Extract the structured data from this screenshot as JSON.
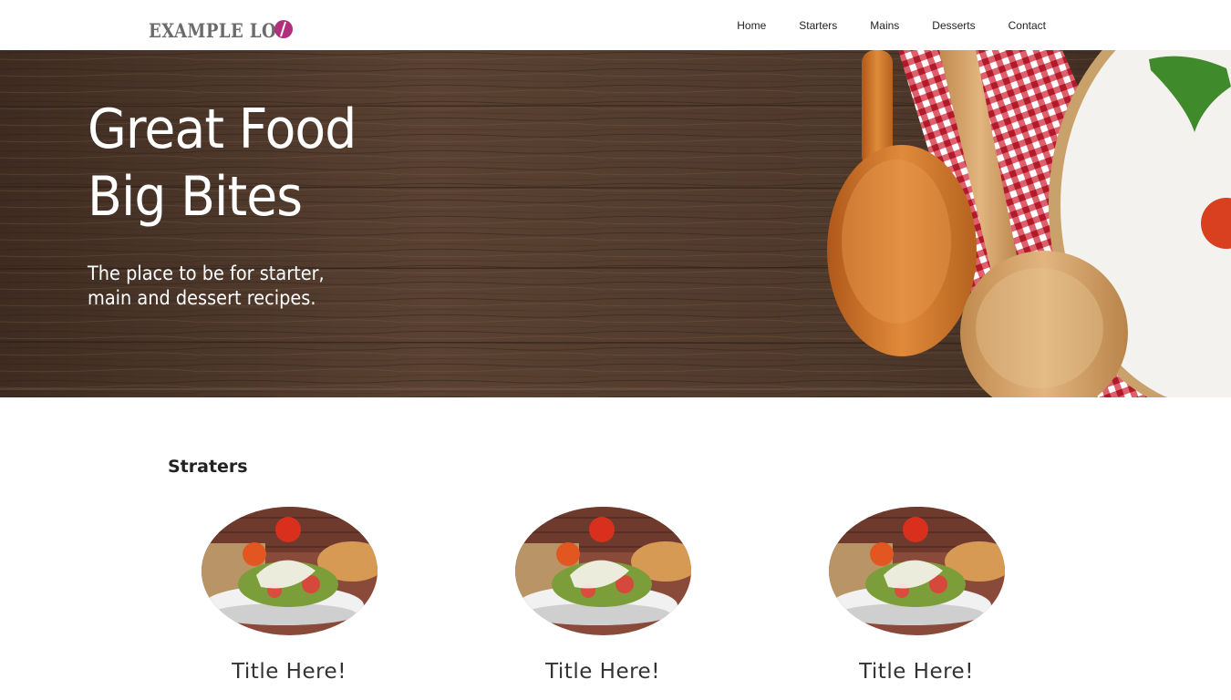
{
  "header": {
    "logo_text": "EXAMPLE LOG",
    "nav": [
      "Home",
      "Starters",
      "Mains",
      "Desserts",
      "Contact"
    ]
  },
  "hero": {
    "title_line1": "Great Food",
    "title_line2": "Big Bites",
    "subtitle_line1": "The place to be for starter,",
    "subtitle_line2": "main and dessert recipes."
  },
  "section": {
    "title": "Straters",
    "cards": [
      {
        "title": "Title Here!"
      },
      {
        "title": "Title Here!"
      },
      {
        "title": "Title Here!"
      }
    ]
  },
  "colors": {
    "logo_accent": "#b0307e",
    "wood": "#5a4130",
    "checkered": "#c8202e"
  },
  "icons": {
    "logo_mark": "logo-mark-icon"
  }
}
